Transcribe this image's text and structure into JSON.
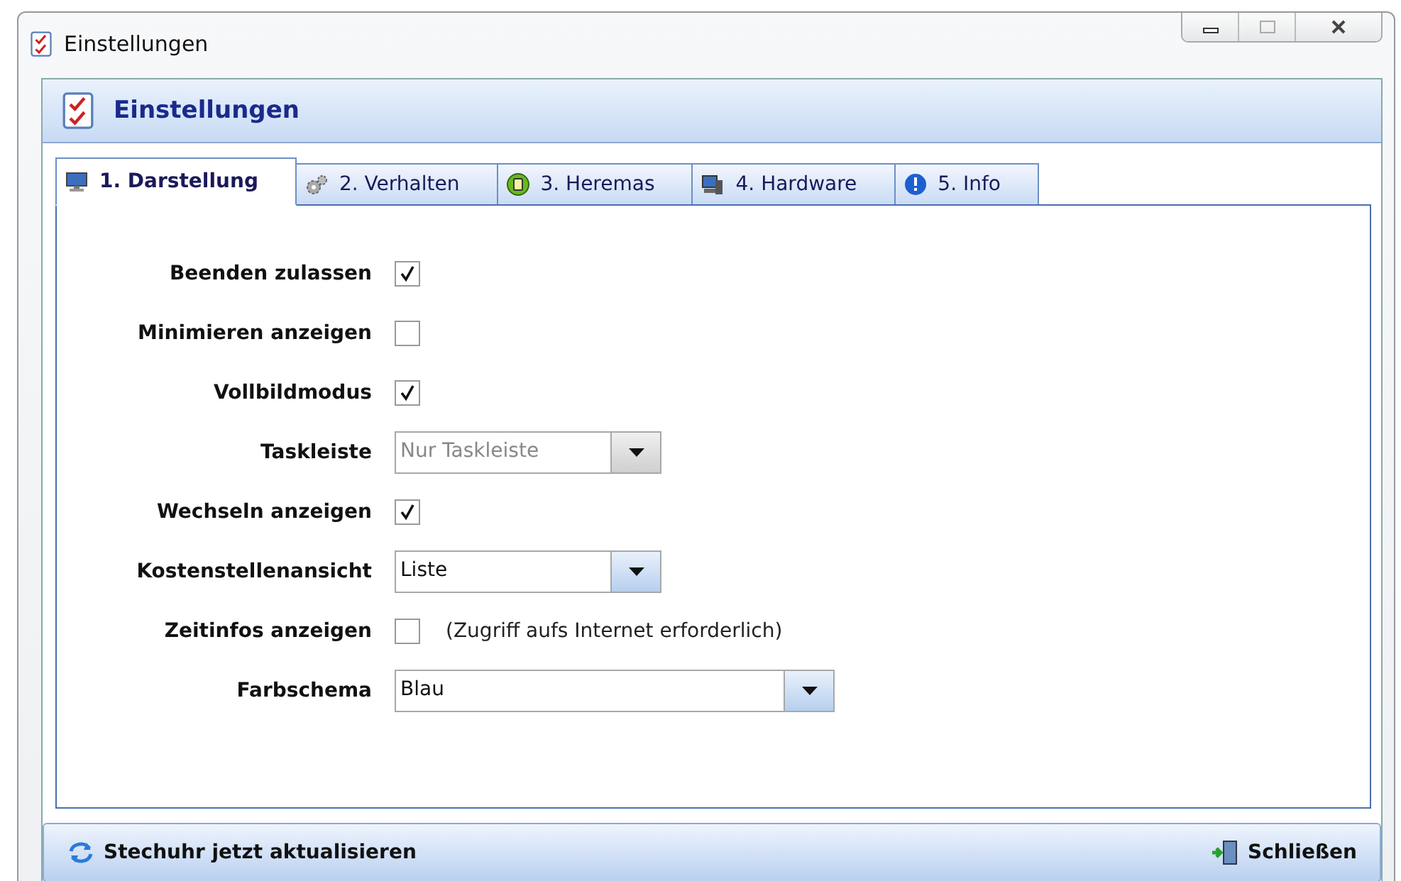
{
  "window": {
    "title": "Einstellungen"
  },
  "header": {
    "title": "Einstellungen"
  },
  "tabs": [
    {
      "label": "1. Darstellung",
      "selected": true
    },
    {
      "label": "2. Verhalten",
      "selected": false
    },
    {
      "label": "3. Heremas",
      "selected": false
    },
    {
      "label": "4. Hardware",
      "selected": false
    },
    {
      "label": "5. Info",
      "selected": false
    }
  ],
  "settings": [
    {
      "label": "Beenden zulassen",
      "kind": "checkbox",
      "checked": true
    },
    {
      "label": "Minimieren anzeigen",
      "kind": "checkbox",
      "checked": false
    },
    {
      "label": "Vollbildmodus",
      "kind": "checkbox",
      "checked": true
    },
    {
      "label": "Taskleiste",
      "kind": "dropdown",
      "value": "Nur Taskleiste",
      "disabled": true
    },
    {
      "label": "Wechseln anzeigen",
      "kind": "checkbox",
      "checked": true
    },
    {
      "label": "Kostenstellenansicht",
      "kind": "dropdown",
      "value": "Liste",
      "disabled": false
    },
    {
      "label": "Zeitinfos anzeigen",
      "kind": "checkbox",
      "checked": false,
      "note": "(Zugriff aufs Internet erforderlich)"
    },
    {
      "label": "Farbschema",
      "kind": "dropdown",
      "value": "Blau",
      "disabled": false
    }
  ],
  "footer": {
    "refresh_button": "Stechuhr jetzt aktualisieren",
    "close_button": "Schließen"
  }
}
